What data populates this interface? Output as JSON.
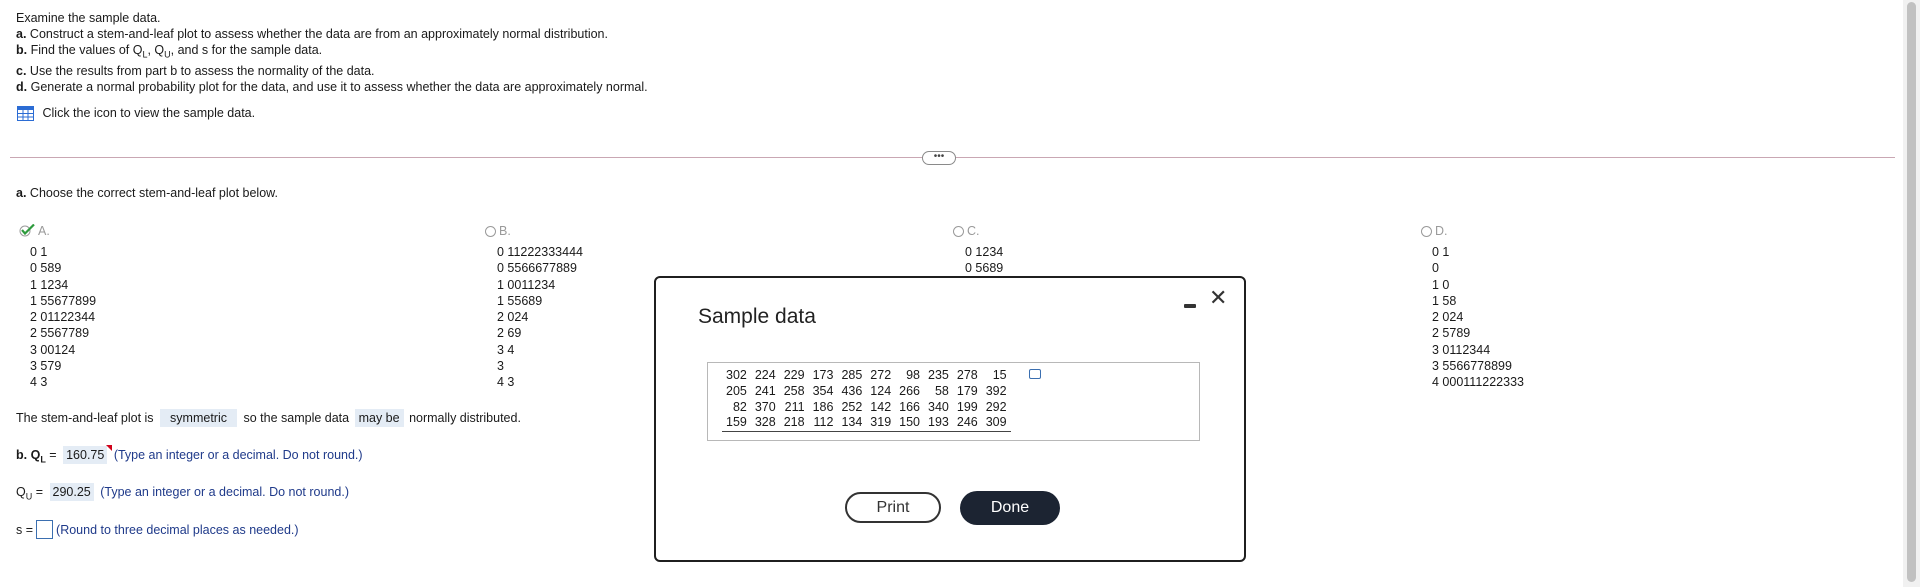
{
  "instructions": {
    "intro": "Examine the sample data.",
    "part_a_label": "a.",
    "part_a_text": "Construct a stem-and-leaf plot to assess whether the data are from an approximately normal distribution.",
    "part_b_label": "b.",
    "part_b_text_pre": "Find the values of Q",
    "part_b_sub_l": "L",
    "part_b_sep": ", Q",
    "part_b_sub_u": "U",
    "part_b_text_post": ", and s for the sample data.",
    "part_c_label": "c.",
    "part_c_text": "Use the results from part b to assess the normality of the data.",
    "part_d_label": "d.",
    "part_d_text": "Generate a normal probability plot for the data, and use it to assess whether the data are approximately normal.",
    "view_data_link": "Click the icon to view the sample data."
  },
  "more_button": "•••",
  "question_a": {
    "prompt_label": "a.",
    "prompt_text": "Choose the correct stem-and-leaf plot below.",
    "options": [
      {
        "letter": "A.",
        "selected": true,
        "rows": [
          "0 1",
          "0 589",
          "1 1234",
          "1 55677899",
          "2 01122344",
          "2 5567789",
          "3 00124",
          "3 579",
          "4 3"
        ]
      },
      {
        "letter": "B.",
        "selected": false,
        "rows": [
          "0 11222333444",
          "0 5566677889",
          "1 0011234",
          "1 55689",
          "2 024",
          "2 69",
          "3 4",
          "3",
          "4 3"
        ]
      },
      {
        "letter": "C.",
        "selected": false,
        "rows": [
          "0 1234",
          "0 5689"
        ]
      },
      {
        "letter": "D.",
        "selected": false,
        "rows": [
          "0 1",
          "0",
          "1 0",
          "1 58",
          "2 024",
          "2 5789",
          "3 0112344",
          "3 5566778899",
          "4 000111222333"
        ]
      }
    ]
  },
  "conclusion": {
    "pre": "The stem-and-leaf plot is",
    "shape": "symmetric",
    "mid": "so the sample data",
    "may": "may be",
    "post": "normally distributed."
  },
  "part_b_answers": {
    "ql_label_pre": "b. Q",
    "ql_sub": "L",
    "ql_eq": "=",
    "ql_value": "160.75",
    "ql_hint": "(Type an integer or a decimal. Do not round.)",
    "qu_label_pre": "Q",
    "qu_sub": "U",
    "qu_eq": "=",
    "qu_value": "290.25",
    "qu_hint": "(Type an integer or a decimal. Do not round.)",
    "s_label": "s =",
    "s_hint": "(Round to three decimal places as needed.)"
  },
  "dialog": {
    "title": "Sample data",
    "table": [
      [
        "302",
        "224",
        "229",
        "173",
        "285",
        "272",
        "98",
        "235",
        "278",
        "15"
      ],
      [
        "205",
        "241",
        "258",
        "354",
        "436",
        "124",
        "266",
        "58",
        "179",
        "392"
      ],
      [
        "82",
        "370",
        "211",
        "186",
        "252",
        "142",
        "166",
        "340",
        "199",
        "292"
      ],
      [
        "159",
        "328",
        "218",
        "112",
        "134",
        "319",
        "150",
        "193",
        "246",
        "309"
      ]
    ],
    "print_label": "Print",
    "done_label": "Done",
    "close_glyph": "✕"
  },
  "colors": {
    "selection_green": "#2e9b3d",
    "answer_fill": "#e4ecf5",
    "hint_blue": "#1f3a8a",
    "done_bg": "#1c2432"
  }
}
